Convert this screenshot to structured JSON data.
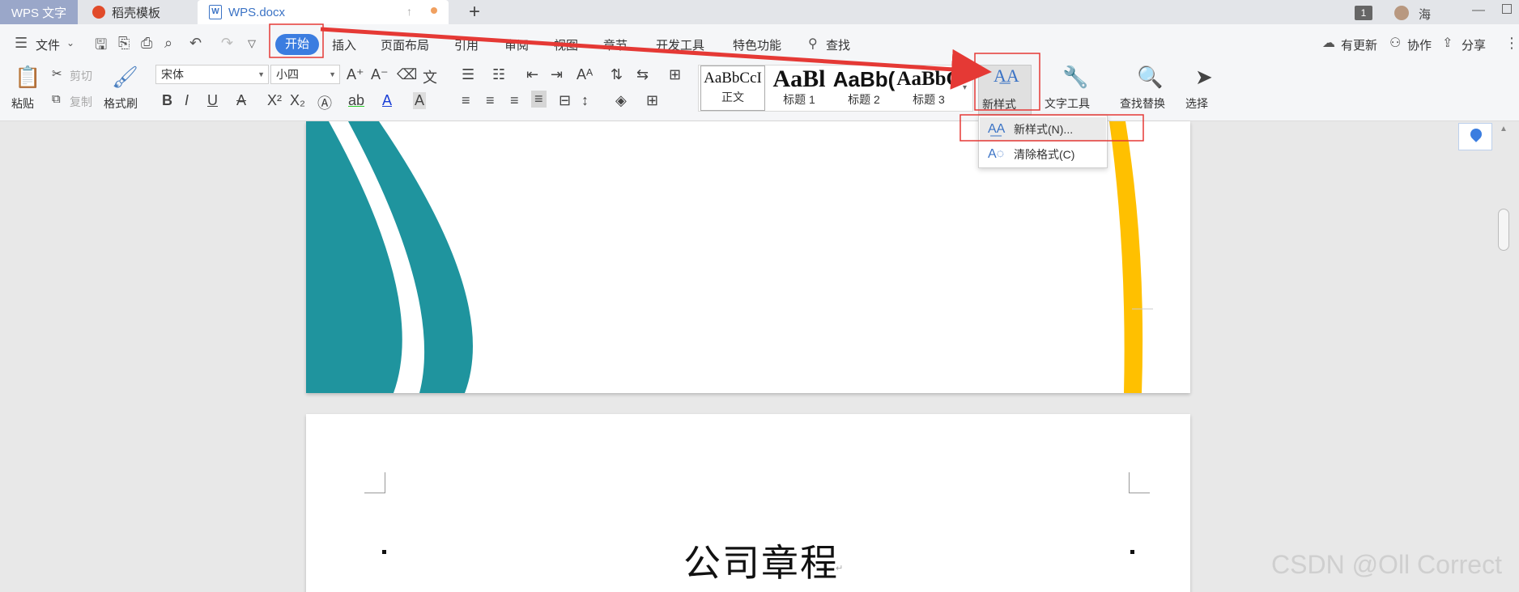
{
  "tabs": {
    "app": "WPS 文字",
    "template": "稻壳模板",
    "document": "WPS.docx",
    "new_tab": "+"
  },
  "titlebar": {
    "badge": "1",
    "user": "海"
  },
  "menu": {
    "file": "文件",
    "start": "开始",
    "insert": "插入",
    "layout": "页面布局",
    "reference": "引用",
    "review": "审阅",
    "view": "视图",
    "section": "章节",
    "developer": "开发工具",
    "special": "特色功能",
    "search": "查找",
    "updates": "有更新",
    "collab": "协作",
    "share": "分享"
  },
  "ribbon": {
    "paste": "粘贴",
    "cut": "剪切",
    "copy": "复制",
    "format_painter": "格式刷",
    "font_name": "宋体",
    "font_size": "小四",
    "styles": [
      {
        "preview": "AaBbCcI",
        "name": "正文"
      },
      {
        "preview": "AaBl",
        "name": "标题 1"
      },
      {
        "preview": "AaBb(",
        "name": "标题 2"
      },
      {
        "preview": "AaBbC",
        "name": "标题 3"
      }
    ],
    "new_style": "新样式",
    "text_tools": "文字工具",
    "find_replace": "查找替换",
    "select": "选择"
  },
  "dropdown": {
    "new_style_item": "新样式(N)...",
    "clear_format_item": "清除格式(C)"
  },
  "document": {
    "title": "公司章程"
  },
  "watermark": "CSDN @Oll Correct",
  "colors": {
    "accent": "#3b7de0",
    "highlight_box": "#e53935",
    "teal": "#1f949e",
    "gold": "#ffc000"
  }
}
